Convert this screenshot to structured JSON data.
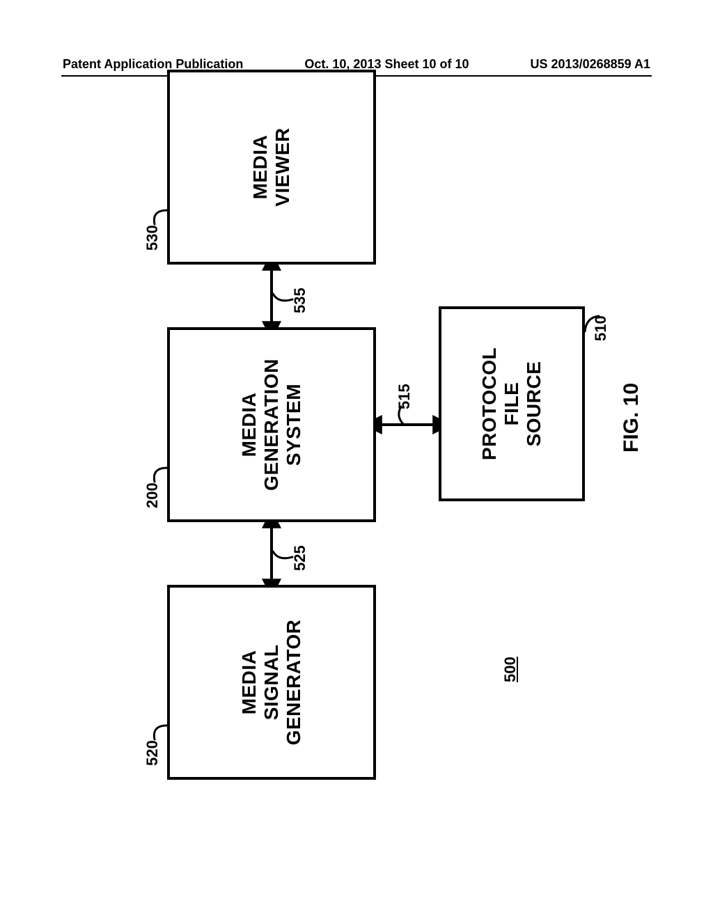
{
  "header": {
    "left": "Patent Application Publication",
    "middle": "Oct. 10, 2013  Sheet 10 of 10",
    "right": "US 2013/0268859 A1"
  },
  "diagram": {
    "boxes": {
      "signal_generator": {
        "label": "MEDIA\nSIGNAL\nGENERATOR",
        "ref": "520"
      },
      "generation_system": {
        "label": "MEDIA\nGENERATION\nSYSTEM",
        "ref": "200"
      },
      "viewer": {
        "label": "MEDIA\nVIEWER",
        "ref": "530"
      },
      "protocol_source": {
        "label": "PROTOCOL\nFILE\nSOURCE",
        "ref": "510"
      }
    },
    "connectors": {
      "signal_to_system": {
        "ref": "525"
      },
      "system_to_viewer": {
        "ref": "535"
      },
      "system_to_protocol": {
        "ref": "515"
      }
    },
    "figure_ref": "500",
    "caption": "FIG. 10"
  }
}
